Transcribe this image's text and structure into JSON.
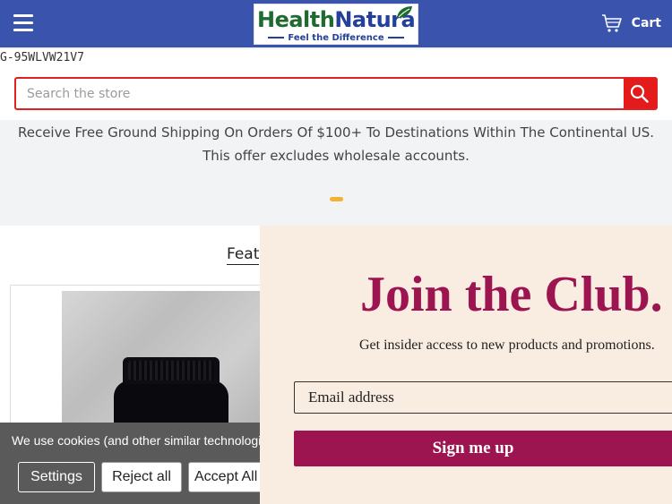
{
  "header": {
    "logo": {
      "word1": "Health",
      "word2": "Natura",
      "tagline": "Feel the Difference"
    },
    "cart_label": "Cart",
    "background": "#3a53ad"
  },
  "tag_id": "G-95WLVW21V7",
  "search": {
    "placeholder": "Search the store",
    "value": ""
  },
  "shipping_notice": "Receive Free Ground Shipping On Orders Of $100+ To Destinations Within The Continental US. This offer excludes wholesale accounts.",
  "featured": {
    "heading": "Feat"
  },
  "cookie_bar": {
    "text": "We use cookies (and other similar technologies) t",
    "settings_label": "Settings",
    "reject_label": "Reject all",
    "accept_label": "Accept All"
  },
  "modal": {
    "title": "Join the Club.",
    "subtitle": "Get insider access to new products and promotions.",
    "email_placeholder": "Email address",
    "email_value": "",
    "signup_label": "Sign me up",
    "accent": "#9c1551",
    "background": "#f9ede2"
  },
  "colors": {
    "search_accent": "#e31b1b",
    "carousel_dot": "#f2b233"
  }
}
